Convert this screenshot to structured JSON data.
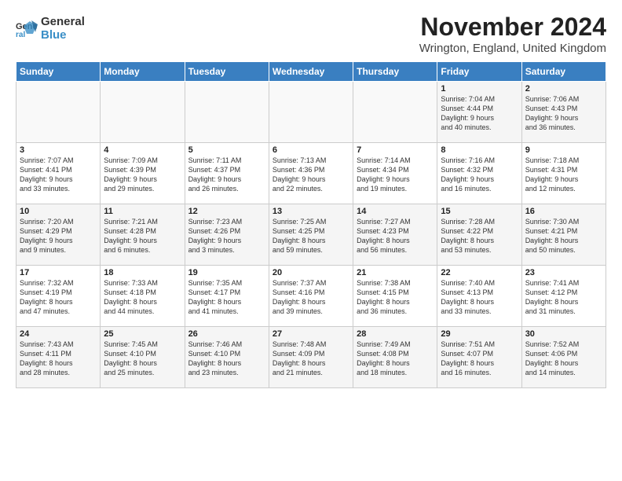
{
  "logo": {
    "line1": "General",
    "line2": "Blue"
  },
  "title": "November 2024",
  "subtitle": "Wrington, England, United Kingdom",
  "headers": [
    "Sunday",
    "Monday",
    "Tuesday",
    "Wednesday",
    "Thursday",
    "Friday",
    "Saturday"
  ],
  "weeks": [
    [
      {
        "day": "",
        "info": ""
      },
      {
        "day": "",
        "info": ""
      },
      {
        "day": "",
        "info": ""
      },
      {
        "day": "",
        "info": ""
      },
      {
        "day": "",
        "info": ""
      },
      {
        "day": "1",
        "info": "Sunrise: 7:04 AM\nSunset: 4:44 PM\nDaylight: 9 hours\nand 40 minutes."
      },
      {
        "day": "2",
        "info": "Sunrise: 7:06 AM\nSunset: 4:43 PM\nDaylight: 9 hours\nand 36 minutes."
      }
    ],
    [
      {
        "day": "3",
        "info": "Sunrise: 7:07 AM\nSunset: 4:41 PM\nDaylight: 9 hours\nand 33 minutes."
      },
      {
        "day": "4",
        "info": "Sunrise: 7:09 AM\nSunset: 4:39 PM\nDaylight: 9 hours\nand 29 minutes."
      },
      {
        "day": "5",
        "info": "Sunrise: 7:11 AM\nSunset: 4:37 PM\nDaylight: 9 hours\nand 26 minutes."
      },
      {
        "day": "6",
        "info": "Sunrise: 7:13 AM\nSunset: 4:36 PM\nDaylight: 9 hours\nand 22 minutes."
      },
      {
        "day": "7",
        "info": "Sunrise: 7:14 AM\nSunset: 4:34 PM\nDaylight: 9 hours\nand 19 minutes."
      },
      {
        "day": "8",
        "info": "Sunrise: 7:16 AM\nSunset: 4:32 PM\nDaylight: 9 hours\nand 16 minutes."
      },
      {
        "day": "9",
        "info": "Sunrise: 7:18 AM\nSunset: 4:31 PM\nDaylight: 9 hours\nand 12 minutes."
      }
    ],
    [
      {
        "day": "10",
        "info": "Sunrise: 7:20 AM\nSunset: 4:29 PM\nDaylight: 9 hours\nand 9 minutes."
      },
      {
        "day": "11",
        "info": "Sunrise: 7:21 AM\nSunset: 4:28 PM\nDaylight: 9 hours\nand 6 minutes."
      },
      {
        "day": "12",
        "info": "Sunrise: 7:23 AM\nSunset: 4:26 PM\nDaylight: 9 hours\nand 3 minutes."
      },
      {
        "day": "13",
        "info": "Sunrise: 7:25 AM\nSunset: 4:25 PM\nDaylight: 8 hours\nand 59 minutes."
      },
      {
        "day": "14",
        "info": "Sunrise: 7:27 AM\nSunset: 4:23 PM\nDaylight: 8 hours\nand 56 minutes."
      },
      {
        "day": "15",
        "info": "Sunrise: 7:28 AM\nSunset: 4:22 PM\nDaylight: 8 hours\nand 53 minutes."
      },
      {
        "day": "16",
        "info": "Sunrise: 7:30 AM\nSunset: 4:21 PM\nDaylight: 8 hours\nand 50 minutes."
      }
    ],
    [
      {
        "day": "17",
        "info": "Sunrise: 7:32 AM\nSunset: 4:19 PM\nDaylight: 8 hours\nand 47 minutes."
      },
      {
        "day": "18",
        "info": "Sunrise: 7:33 AM\nSunset: 4:18 PM\nDaylight: 8 hours\nand 44 minutes."
      },
      {
        "day": "19",
        "info": "Sunrise: 7:35 AM\nSunset: 4:17 PM\nDaylight: 8 hours\nand 41 minutes."
      },
      {
        "day": "20",
        "info": "Sunrise: 7:37 AM\nSunset: 4:16 PM\nDaylight: 8 hours\nand 39 minutes."
      },
      {
        "day": "21",
        "info": "Sunrise: 7:38 AM\nSunset: 4:15 PM\nDaylight: 8 hours\nand 36 minutes."
      },
      {
        "day": "22",
        "info": "Sunrise: 7:40 AM\nSunset: 4:13 PM\nDaylight: 8 hours\nand 33 minutes."
      },
      {
        "day": "23",
        "info": "Sunrise: 7:41 AM\nSunset: 4:12 PM\nDaylight: 8 hours\nand 31 minutes."
      }
    ],
    [
      {
        "day": "24",
        "info": "Sunrise: 7:43 AM\nSunset: 4:11 PM\nDaylight: 8 hours\nand 28 minutes."
      },
      {
        "day": "25",
        "info": "Sunrise: 7:45 AM\nSunset: 4:10 PM\nDaylight: 8 hours\nand 25 minutes."
      },
      {
        "day": "26",
        "info": "Sunrise: 7:46 AM\nSunset: 4:10 PM\nDaylight: 8 hours\nand 23 minutes."
      },
      {
        "day": "27",
        "info": "Sunrise: 7:48 AM\nSunset: 4:09 PM\nDaylight: 8 hours\nand 21 minutes."
      },
      {
        "day": "28",
        "info": "Sunrise: 7:49 AM\nSunset: 4:08 PM\nDaylight: 8 hours\nand 18 minutes."
      },
      {
        "day": "29",
        "info": "Sunrise: 7:51 AM\nSunset: 4:07 PM\nDaylight: 8 hours\nand 16 minutes."
      },
      {
        "day": "30",
        "info": "Sunrise: 7:52 AM\nSunset: 4:06 PM\nDaylight: 8 hours\nand 14 minutes."
      }
    ]
  ]
}
